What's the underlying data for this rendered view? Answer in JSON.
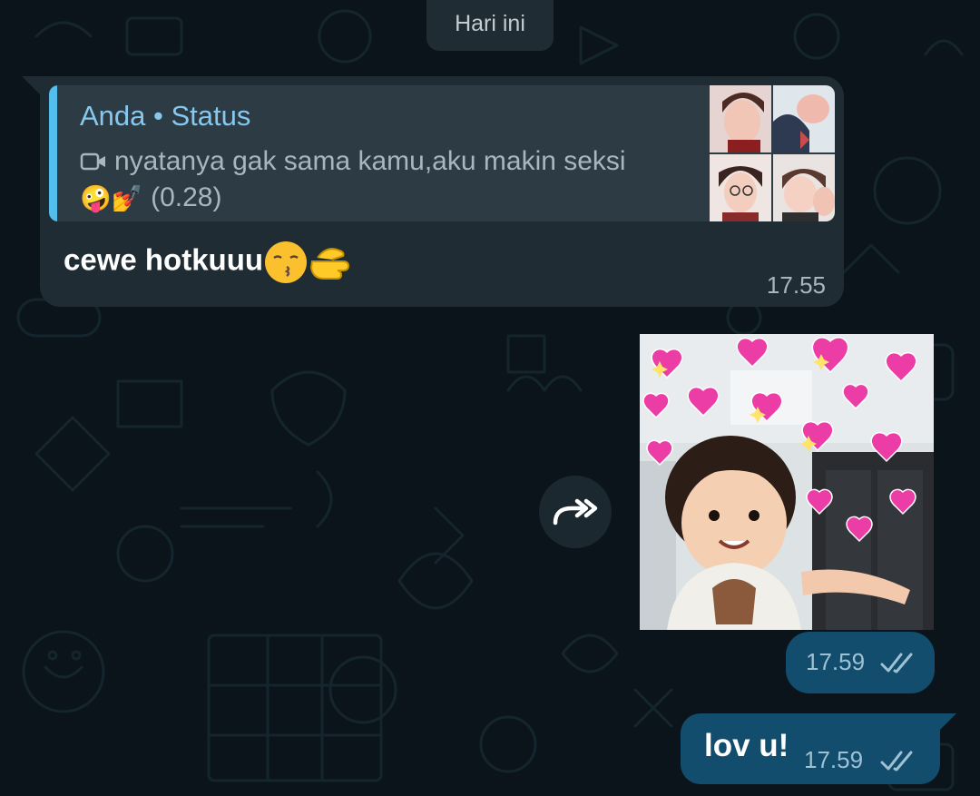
{
  "date_separator": "Hari ini",
  "incoming_message": {
    "quote": {
      "title": "Anda • Status",
      "media_icon": "video-camera-icon",
      "caption": "nyatanya gak sama kamu,aku makin seksi",
      "caption_emojis": "🤪💅",
      "duration": "(0.28)"
    },
    "text": "cewe hotkuuu",
    "emojis": [
      "kissing-face-emoji",
      "pointing-hand-emoji"
    ],
    "time": "17.55"
  },
  "forward_button": {
    "icon": "forward-icon"
  },
  "sticker_message": {
    "sticker": "hearts-child-sticker",
    "time": "17.59",
    "status_icon": "double-check-icon"
  },
  "outgoing_message": {
    "text": "lov u!",
    "time": "17.59",
    "status_icon": "double-check-icon"
  },
  "colors": {
    "background": "#0b141a",
    "incoming_bubble": "#1f2c34",
    "outgoing_bubble": "#134d6d",
    "quote_accent": "#53bdeb"
  }
}
